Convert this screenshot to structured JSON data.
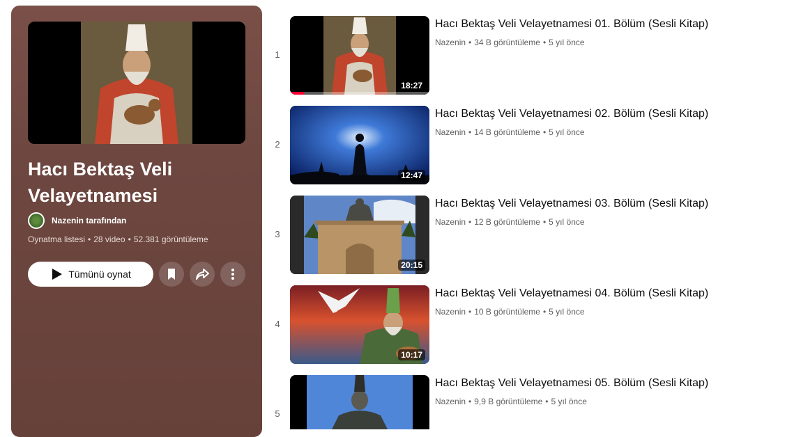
{
  "playlist": {
    "title": "Hacı Bektaş Veli Velayetnamesi",
    "owner": "Nazenin tarafından",
    "type": "Oynatma listesi",
    "video_count": "28 video",
    "views": "52.381 görüntüleme",
    "play_all_label": "Tümünü oynat",
    "icons": [
      "bookmark-icon",
      "share-icon",
      "more-icon"
    ],
    "accent_bg": "#6d4740"
  },
  "videos": [
    {
      "index": "1",
      "title": "Hacı Bektaş Veli Velayetnamesi 01. Bölüm (Sesli Kitap)",
      "channel": "Nazenin",
      "views": "34 B görüntüleme",
      "age": "5 yıl önce",
      "duration": "18:27",
      "watched": 0.1
    },
    {
      "index": "2",
      "title": "Hacı Bektaş Veli Velayetnamesi 02. Bölüm (Sesli Kitap)",
      "channel": "Nazenin",
      "views": "14 B görüntüleme",
      "age": "5 yıl önce",
      "duration": "12:47"
    },
    {
      "index": "3",
      "title": "Hacı Bektaş Veli Velayetnamesi 03. Bölüm (Sesli Kitap)",
      "channel": "Nazenin",
      "views": "12 B görüntüleme",
      "age": "5 yıl önce",
      "duration": "20:15"
    },
    {
      "index": "4",
      "title": "Hacı Bektaş Veli Velayetnamesi 04. Bölüm (Sesli Kitap)",
      "channel": "Nazenin",
      "views": "10 B görüntüleme",
      "age": "5 yıl önce",
      "duration": "10:17"
    },
    {
      "index": "5",
      "title": "Hacı Bektaş Veli Velayetnamesi 05. Bölüm (Sesli Kitap)",
      "channel": "Nazenin",
      "views": "9,9 B görüntüleme",
      "age": "5 yıl önce",
      "duration": ""
    }
  ]
}
